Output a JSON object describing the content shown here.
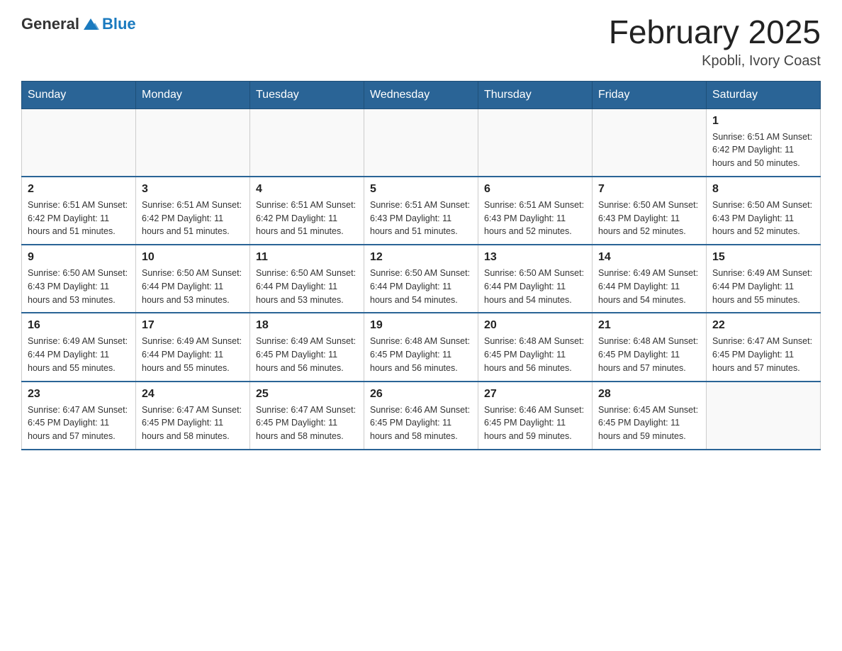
{
  "header": {
    "logo_general": "General",
    "logo_blue": "Blue",
    "title": "February 2025",
    "subtitle": "Kpobli, Ivory Coast"
  },
  "days_of_week": [
    "Sunday",
    "Monday",
    "Tuesday",
    "Wednesday",
    "Thursday",
    "Friday",
    "Saturday"
  ],
  "weeks": [
    [
      {
        "day": "",
        "info": ""
      },
      {
        "day": "",
        "info": ""
      },
      {
        "day": "",
        "info": ""
      },
      {
        "day": "",
        "info": ""
      },
      {
        "day": "",
        "info": ""
      },
      {
        "day": "",
        "info": ""
      },
      {
        "day": "1",
        "info": "Sunrise: 6:51 AM\nSunset: 6:42 PM\nDaylight: 11 hours\nand 50 minutes."
      }
    ],
    [
      {
        "day": "2",
        "info": "Sunrise: 6:51 AM\nSunset: 6:42 PM\nDaylight: 11 hours\nand 51 minutes."
      },
      {
        "day": "3",
        "info": "Sunrise: 6:51 AM\nSunset: 6:42 PM\nDaylight: 11 hours\nand 51 minutes."
      },
      {
        "day": "4",
        "info": "Sunrise: 6:51 AM\nSunset: 6:42 PM\nDaylight: 11 hours\nand 51 minutes."
      },
      {
        "day": "5",
        "info": "Sunrise: 6:51 AM\nSunset: 6:43 PM\nDaylight: 11 hours\nand 51 minutes."
      },
      {
        "day": "6",
        "info": "Sunrise: 6:51 AM\nSunset: 6:43 PM\nDaylight: 11 hours\nand 52 minutes."
      },
      {
        "day": "7",
        "info": "Sunrise: 6:50 AM\nSunset: 6:43 PM\nDaylight: 11 hours\nand 52 minutes."
      },
      {
        "day": "8",
        "info": "Sunrise: 6:50 AM\nSunset: 6:43 PM\nDaylight: 11 hours\nand 52 minutes."
      }
    ],
    [
      {
        "day": "9",
        "info": "Sunrise: 6:50 AM\nSunset: 6:43 PM\nDaylight: 11 hours\nand 53 minutes."
      },
      {
        "day": "10",
        "info": "Sunrise: 6:50 AM\nSunset: 6:44 PM\nDaylight: 11 hours\nand 53 minutes."
      },
      {
        "day": "11",
        "info": "Sunrise: 6:50 AM\nSunset: 6:44 PM\nDaylight: 11 hours\nand 53 minutes."
      },
      {
        "day": "12",
        "info": "Sunrise: 6:50 AM\nSunset: 6:44 PM\nDaylight: 11 hours\nand 54 minutes."
      },
      {
        "day": "13",
        "info": "Sunrise: 6:50 AM\nSunset: 6:44 PM\nDaylight: 11 hours\nand 54 minutes."
      },
      {
        "day": "14",
        "info": "Sunrise: 6:49 AM\nSunset: 6:44 PM\nDaylight: 11 hours\nand 54 minutes."
      },
      {
        "day": "15",
        "info": "Sunrise: 6:49 AM\nSunset: 6:44 PM\nDaylight: 11 hours\nand 55 minutes."
      }
    ],
    [
      {
        "day": "16",
        "info": "Sunrise: 6:49 AM\nSunset: 6:44 PM\nDaylight: 11 hours\nand 55 minutes."
      },
      {
        "day": "17",
        "info": "Sunrise: 6:49 AM\nSunset: 6:44 PM\nDaylight: 11 hours\nand 55 minutes."
      },
      {
        "day": "18",
        "info": "Sunrise: 6:49 AM\nSunset: 6:45 PM\nDaylight: 11 hours\nand 56 minutes."
      },
      {
        "day": "19",
        "info": "Sunrise: 6:48 AM\nSunset: 6:45 PM\nDaylight: 11 hours\nand 56 minutes."
      },
      {
        "day": "20",
        "info": "Sunrise: 6:48 AM\nSunset: 6:45 PM\nDaylight: 11 hours\nand 56 minutes."
      },
      {
        "day": "21",
        "info": "Sunrise: 6:48 AM\nSunset: 6:45 PM\nDaylight: 11 hours\nand 57 minutes."
      },
      {
        "day": "22",
        "info": "Sunrise: 6:47 AM\nSunset: 6:45 PM\nDaylight: 11 hours\nand 57 minutes."
      }
    ],
    [
      {
        "day": "23",
        "info": "Sunrise: 6:47 AM\nSunset: 6:45 PM\nDaylight: 11 hours\nand 57 minutes."
      },
      {
        "day": "24",
        "info": "Sunrise: 6:47 AM\nSunset: 6:45 PM\nDaylight: 11 hours\nand 58 minutes."
      },
      {
        "day": "25",
        "info": "Sunrise: 6:47 AM\nSunset: 6:45 PM\nDaylight: 11 hours\nand 58 minutes."
      },
      {
        "day": "26",
        "info": "Sunrise: 6:46 AM\nSunset: 6:45 PM\nDaylight: 11 hours\nand 58 minutes."
      },
      {
        "day": "27",
        "info": "Sunrise: 6:46 AM\nSunset: 6:45 PM\nDaylight: 11 hours\nand 59 minutes."
      },
      {
        "day": "28",
        "info": "Sunrise: 6:45 AM\nSunset: 6:45 PM\nDaylight: 11 hours\nand 59 minutes."
      },
      {
        "day": "",
        "info": ""
      }
    ]
  ]
}
